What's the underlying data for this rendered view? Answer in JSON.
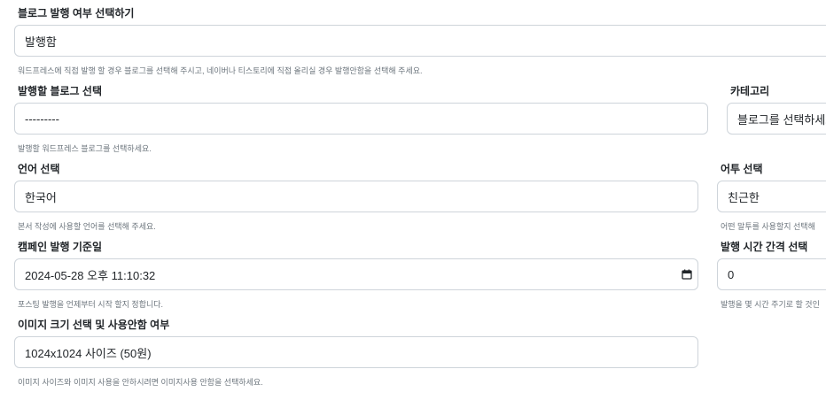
{
  "publish": {
    "label": "블로그 발행 여부 선택하기",
    "value": "발행함",
    "help": "워드프레스에 직접 발행 할 경우 블로그를 선택해 주시고, 네이버나 티스토리에 직접 올리실 경우 발행안함을 선택해 주세요."
  },
  "blog": {
    "label": "발행할 블로그 선택",
    "value": "---------",
    "help": "발행할 워드프레스 블로그를 선택하세요."
  },
  "category": {
    "label": "카테고리",
    "value": "블로그를 선택하세요"
  },
  "language": {
    "label": "언어 선택",
    "value": "한국어",
    "help": "본서 작성에 사용할 언어를 선택해 주세요."
  },
  "tone": {
    "label": "어투 선택",
    "value": "친근한",
    "help": "어떤 말투를 사용할지 선택해"
  },
  "campaign_date": {
    "label": "캠페인 발행 기준일",
    "value": "2024-05-28 오후 11:10:32",
    "help": "포스팅 발행을 언제부터 시작 할지 정합니다.",
    "icon": "calendar-icon"
  },
  "interval": {
    "label": "발행 시간 간격 선택",
    "value": "0",
    "help": "발행을 몇 시간 주기로 할 것인"
  },
  "image_size": {
    "label": "이미지 크기 선택 및 사용안함 여부",
    "value": "1024x1024 사이즈 (50원)",
    "help": "이미지 사이즈와 이미지 사용을 안하시려면 이미지사용 안함을 선택하세요."
  }
}
